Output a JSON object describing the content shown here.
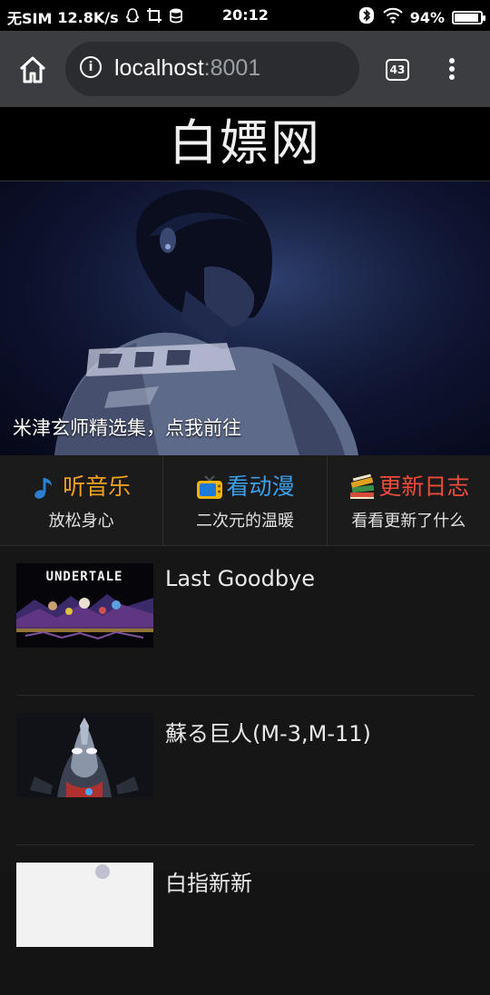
{
  "status_bar": {
    "carrier": "无SIM",
    "speed": "12.8K/s",
    "time": "20:12",
    "battery_pct": "94%",
    "battery_level": 0.94,
    "icons": [
      "qq-icon",
      "screenshot-icon",
      "storage-icon",
      "bluetooth-icon",
      "wifi-icon",
      "battery-icon"
    ]
  },
  "browser": {
    "url_host": "localhost",
    "url_port": ":8001",
    "tab_count": "43",
    "icons": [
      "home-icon",
      "info-icon",
      "tab-switcher-icon",
      "more-menu-icon"
    ]
  },
  "site": {
    "title": "白嫖网"
  },
  "banner": {
    "caption": "米津玄师精选集，点我前往"
  },
  "categories": [
    {
      "title": "听音乐",
      "subtitle": "放松身心",
      "color": "#f0a020",
      "icon": "music-note-icon"
    },
    {
      "title": "看动漫",
      "subtitle": "二次元的温暖",
      "color": "#3aa0ec",
      "icon": "tv-icon"
    },
    {
      "title": "更新日志",
      "subtitle": "看看更新了什么",
      "color": "#ee4b3c",
      "icon": "books-icon"
    }
  ],
  "list_items": [
    {
      "title": "Last Goodbye",
      "thumb_text": "UNDERTALE"
    },
    {
      "title": "蘇る巨人(M-3,M-11)"
    },
    {
      "title": "白指新新"
    }
  ]
}
